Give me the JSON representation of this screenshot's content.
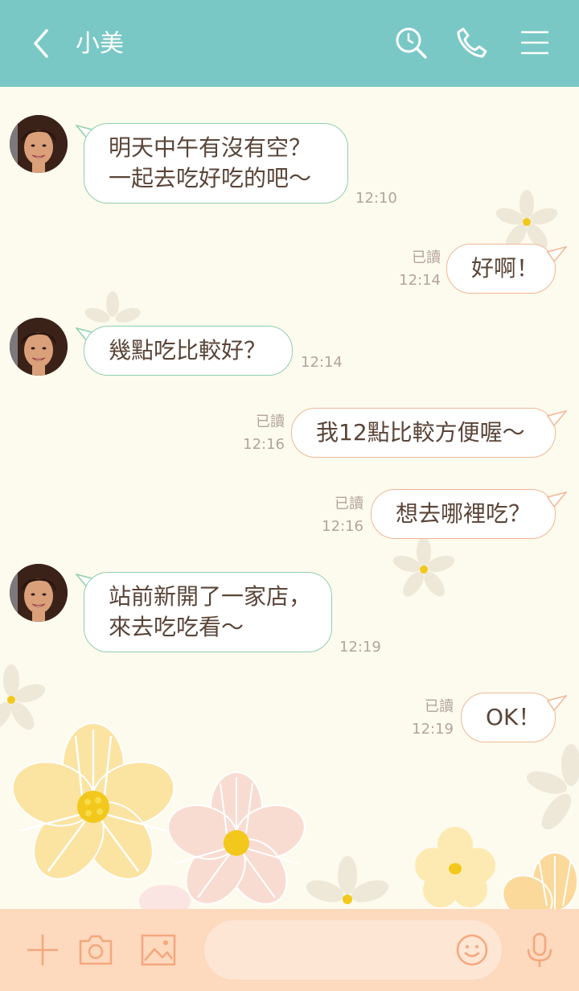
{
  "header": {
    "title": "小美",
    "icons": [
      "back-icon",
      "search-icon",
      "phone-icon",
      "menu-icon"
    ],
    "background": "#79c8c6"
  },
  "messages": [
    {
      "side": "in",
      "text": "明天中午有沒有空？\n一起去吃好吃的吧～",
      "time": "12:10"
    },
    {
      "side": "out",
      "text": "好啊！",
      "read": "已讀",
      "time": "12:14"
    },
    {
      "side": "in",
      "text": "幾點吃比較好？",
      "time": "12:14"
    },
    {
      "side": "out",
      "text": "我12點比較方便喔～",
      "read": "已讀",
      "time": "12:16"
    },
    {
      "side": "out",
      "text": "想去哪裡吃？",
      "read": "已讀",
      "time": "12:16"
    },
    {
      "side": "in",
      "text": "站前新開了一家店，\n來去吃吃看～",
      "time": "12:19"
    },
    {
      "side": "out",
      "text": "OK！",
      "read": "已讀",
      "time": "12:19"
    }
  ],
  "bottombar": {
    "icons": [
      "plus-icon",
      "camera-icon",
      "image-icon",
      "emoji-icon",
      "mic-icon"
    ],
    "input_placeholder": "",
    "background": "#fdd9bd"
  },
  "colors": {
    "incoming_border": "#8fd0ae",
    "outgoing_border": "#f0b895",
    "text": "#5a4538",
    "meta": "#b3a49c"
  }
}
